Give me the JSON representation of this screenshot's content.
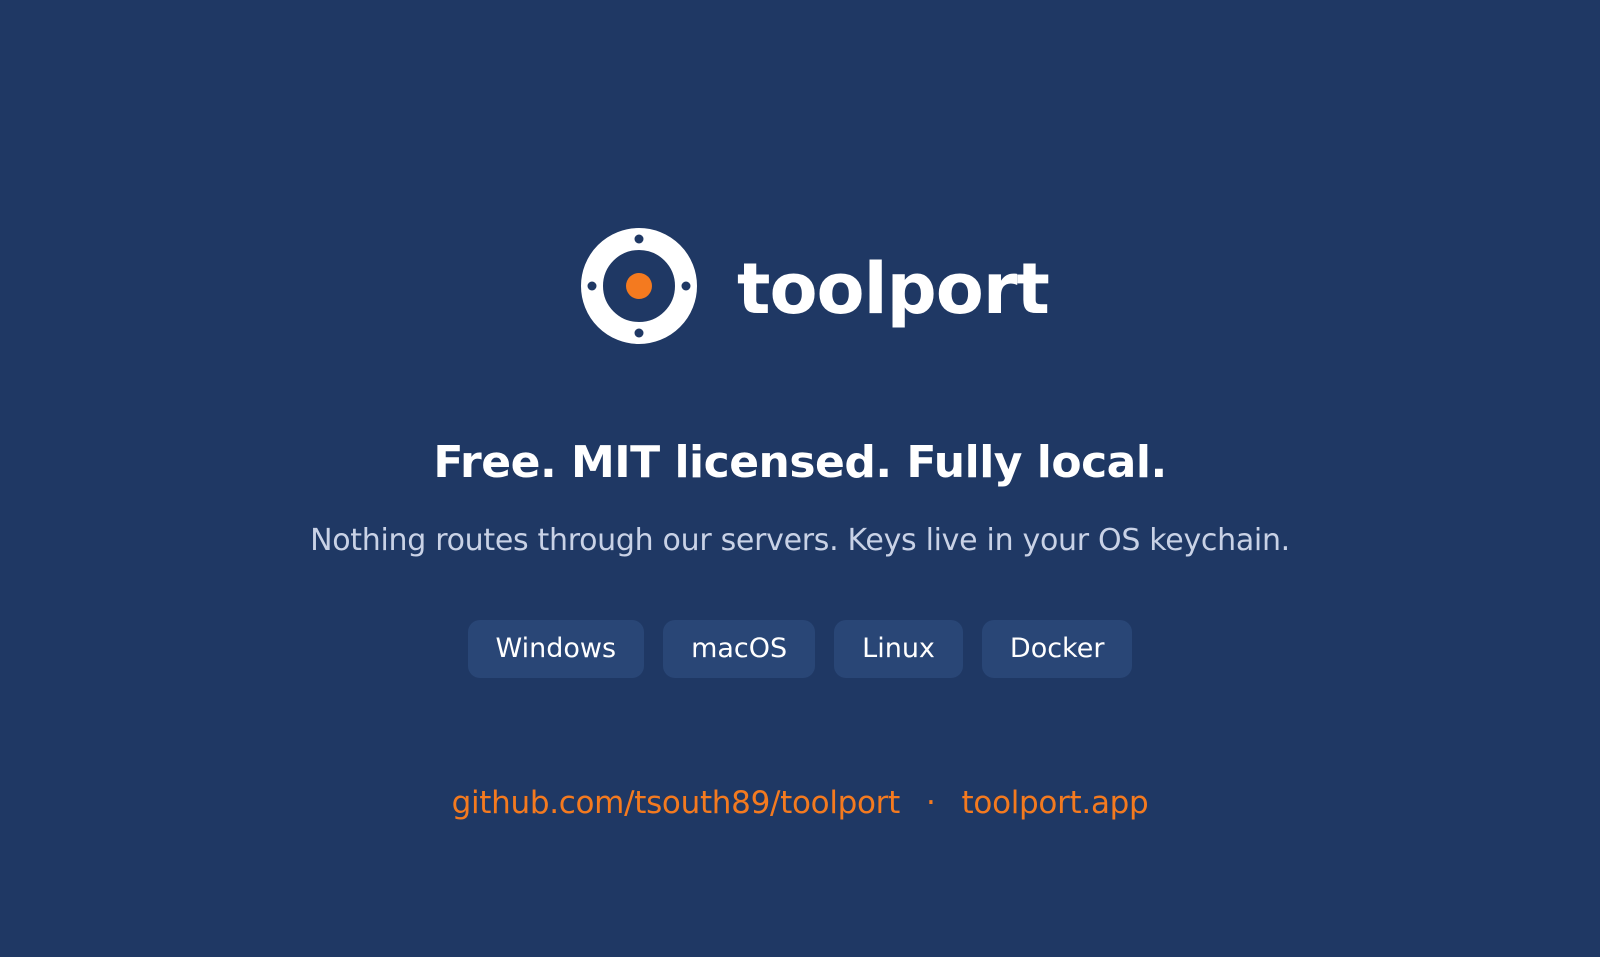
{
  "brand": {
    "name": "toolport",
    "logo_icon": "target-ring-icon"
  },
  "hero": {
    "headline": "Free. MIT licensed. Fully local.",
    "subline": "Nothing routes through our servers. Keys live in your OS keychain."
  },
  "platforms": [
    "Windows",
    "macOS",
    "Linux",
    "Docker"
  ],
  "links": {
    "repo": "github.com/tsouth89/toolport",
    "separator": "·",
    "site": "toolport.app"
  },
  "colors": {
    "background": "#1f3864",
    "accent": "#f47a1f",
    "pill": "#294676",
    "text": "#ffffff",
    "muted_text": "#c9d2e6"
  }
}
